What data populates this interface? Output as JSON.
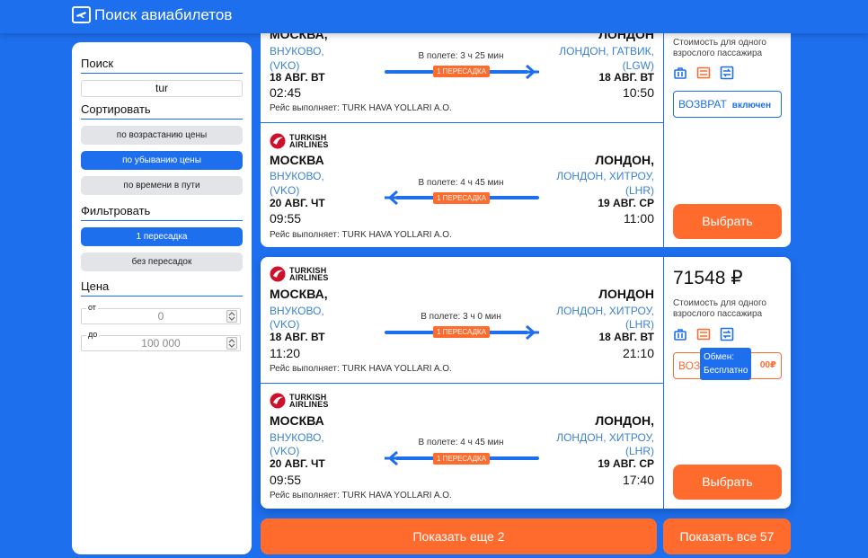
{
  "app": {
    "title": "Поиск авиабилетов",
    "icon": "ticket-icon"
  },
  "sidebar": {
    "search_heading": "Поиск",
    "search_value": "tur",
    "sort_heading": "Сортировать",
    "sort_options": [
      "по возрастанию цены",
      "по убыванию цены",
      "по времени в пути"
    ],
    "sort_selected": "по убыванию цены",
    "filter_heading": "Фильтровать",
    "filter_options": [
      "1 пересадка",
      "без пересадок"
    ],
    "filter_selected": "1 пересадка",
    "price_heading": "Цена",
    "price_from_label": "от",
    "price_from_placeholder": "0",
    "price_to_label": "до",
    "price_to_placeholder": "100 000"
  },
  "offers": [
    {
      "price": "",
      "price_sub": "Стоимость для одного взрослого пассажира",
      "return_label": "ВОЗВРАТ",
      "return_value": "включен",
      "select_label": "Выбрать",
      "segments": [
        {
          "airline": "",
          "from_city": "МОСКВА,",
          "from_airport_1": "ВНУКОВО,",
          "from_airport_2": "(VKO)",
          "from_date": "18 АВГ. ВТ",
          "from_time": "02:45",
          "duration": "В полете: 3 ч 25 мин",
          "stops": "1 ПЕРЕСАДКА",
          "to_city": "ЛОНДОН",
          "to_airport_1": "ЛОНДОН, ГАТВИК,",
          "to_airport_2": "(LGW)",
          "to_date": "18 АВГ. ВТ",
          "to_time": "10:50",
          "operator": "Рейс выполняет: TURK HAVA YOLLARI A.O.",
          "direction": "forward"
        },
        {
          "airline": "TURKISH AIRLINES",
          "from_city": "МОСКВА",
          "from_airport_1": "ВНУКОВО,",
          "from_airport_2": "(VKO)",
          "from_date": "20 АВГ. ЧТ",
          "from_time": "09:55",
          "duration": "В полете: 4 ч 45 мин",
          "stops": "1 ПЕРЕСАДКА",
          "to_city": "ЛОНДОН,",
          "to_airport_1": "ЛОНДОН, ХИТРОУ,",
          "to_airport_2": "(LHR)",
          "to_date": "19 АВГ. СР",
          "to_time": "11:00",
          "operator": "Рейс выполняет: TURK HAVA YOLLARI A.O.",
          "direction": "back"
        }
      ]
    },
    {
      "price": "71548 ₽",
      "price_sub": "Стоимость для одного взрослого пассажира",
      "return_label": "ВОЗ",
      "return_value": "00₽",
      "tooltip_line1": "Обмен:",
      "tooltip_line2": "Бесплатно",
      "select_label": "Выбрать",
      "segments": [
        {
          "airline": "TURKISH AIRLINES",
          "from_city": "МОСКВА,",
          "from_airport_1": "ВНУКОВО,",
          "from_airport_2": "(VKO)",
          "from_date": "18 АВГ. ВТ",
          "from_time": "11:20",
          "duration": "В полете: 3 ч 0 мин",
          "stops": "1 ПЕРЕСАДКА",
          "to_city": "ЛОНДОН",
          "to_airport_1": "ЛОНДОН, ХИТРОУ,",
          "to_airport_2": "(LHR)",
          "to_date": "18 АВГ. ВТ",
          "to_time": "21:10",
          "operator": "Рейс выполняет: TURK HAVA YOLLARI A.O.",
          "direction": "forward"
        },
        {
          "airline": "TURKISH AIRLINES",
          "from_city": "МОСКВА",
          "from_airport_1": "ВНУКОВО,",
          "from_airport_2": "(VKO)",
          "from_date": "20 АВГ. ЧТ",
          "from_time": "09:55",
          "duration": "В полете: 4 ч 45 мин",
          "stops": "1 ПЕРЕСАДКА",
          "to_city": "ЛОНДОН,",
          "to_airport_1": "ЛОНДОН, ХИТРОУ,",
          "to_airport_2": "(LHR)",
          "to_date": "19 АВГ. СР",
          "to_time": "17:40",
          "operator": "Рейс выполняет: TURK HAVA YOLLARI A.O.",
          "direction": "back"
        }
      ]
    }
  ],
  "show_more_label": "Показать еще 2",
  "show_all_label": "Показать все 57",
  "colors": {
    "primary": "#1d6fee",
    "accent": "#ff6b2c",
    "link": "#3b82d6"
  }
}
